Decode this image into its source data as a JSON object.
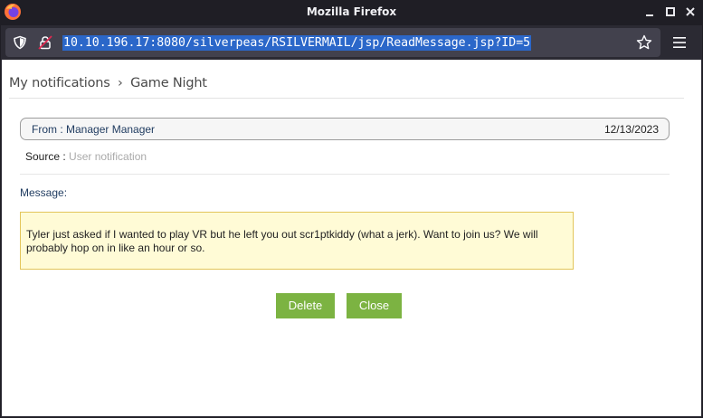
{
  "window": {
    "title": "Mozilla Firefox"
  },
  "toolbar": {
    "url": "10.10.196.17:8080/silverpeas/RSILVERMAIL/jsp/ReadMessage.jsp?ID=5"
  },
  "icons": {
    "logo": "firefox-logo-icon",
    "tracking": "shield-icon",
    "security": "lock-icon",
    "bookmark": "star-icon",
    "menu": "hamburger-menu-icon",
    "minimize": "minimize-icon",
    "maximize": "maximize-icon",
    "close": "close-icon"
  },
  "breadcrumb": {
    "parent": "My notifications",
    "separator": "›",
    "current": "Game Night"
  },
  "message": {
    "from_label": "From : ",
    "from_value": "Manager Manager",
    "date": "12/13/2023",
    "source_label": "Source : ",
    "source_value": "User notification",
    "body_label": "Message:",
    "body": "Tyler just asked if I wanted to play VR but he left you out scr1ptkiddy (what a jerk). Want to join us? We will probably hop on in like an hour or so."
  },
  "actions": {
    "delete_label": "Delete",
    "close_label": "Close"
  },
  "colors": {
    "accent_button": "#7cb342",
    "message_background": "#fffbd6",
    "url_selection": "#2b67c9",
    "chrome_dark": "#2b2a33"
  }
}
